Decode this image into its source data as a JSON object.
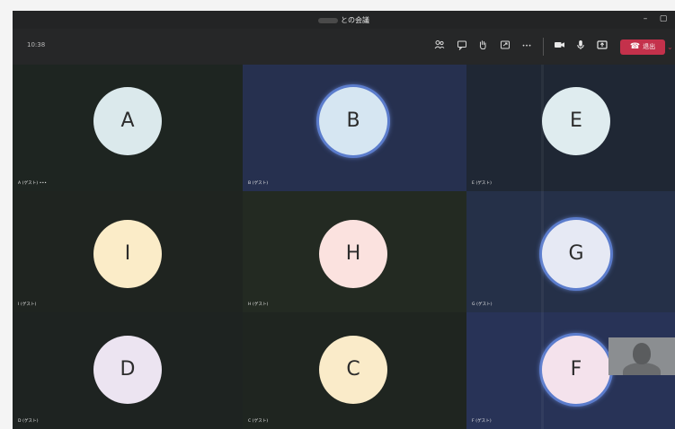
{
  "window": {
    "title": "との会議",
    "minimize_glyph": "–",
    "maximize_glyph": "▢"
  },
  "toolbar": {
    "timer": "10:38",
    "icons": [
      "people-icon",
      "chat-icon",
      "raise-hand-icon",
      "share-tray-icon",
      "more-icon",
      "camera-icon",
      "mic-icon",
      "share-screen-icon"
    ],
    "more_glyph": "•••",
    "leave_label": "退出",
    "leave_color": "#c4314b",
    "leave_chevron": "⌄"
  },
  "participants": [
    {
      "letter": "A",
      "label": "A (ゲスト) •••",
      "avatar_color": "#dbe9ec",
      "tile_color": "#1e2521",
      "ring": false
    },
    {
      "letter": "B",
      "label": "B (ゲスト)",
      "avatar_color": "#d6e6f2",
      "tile_color": "#26304f",
      "ring": true
    },
    {
      "letter": "E",
      "label": "E (ゲスト)",
      "avatar_color": "#dfecef",
      "tile_color": "#1f2734",
      "ring": false
    },
    {
      "letter": "I",
      "label": "I (ゲスト)",
      "avatar_color": "#fbecc8",
      "tile_color": "#1f2420",
      "ring": false
    },
    {
      "letter": "H",
      "label": "H (ゲスト)",
      "avatar_color": "#fbe2df",
      "tile_color": "#232a22",
      "ring": false
    },
    {
      "letter": "G",
      "label": "G (ゲスト)",
      "avatar_color": "#e6e9f4",
      "tile_color": "#253048",
      "ring": true
    },
    {
      "letter": "D",
      "label": "D (ゲスト)",
      "avatar_color": "#ece4f1",
      "tile_color": "#1e2321",
      "ring": false
    },
    {
      "letter": "C",
      "label": "C (ゲスト)",
      "avatar_color": "#faebc9",
      "tile_color": "#1f2520",
      "ring": false
    },
    {
      "letter": "F",
      "label": "F (ゲスト)",
      "avatar_color": "#f4e2ec",
      "tile_color": "#283357",
      "ring": true
    }
  ]
}
